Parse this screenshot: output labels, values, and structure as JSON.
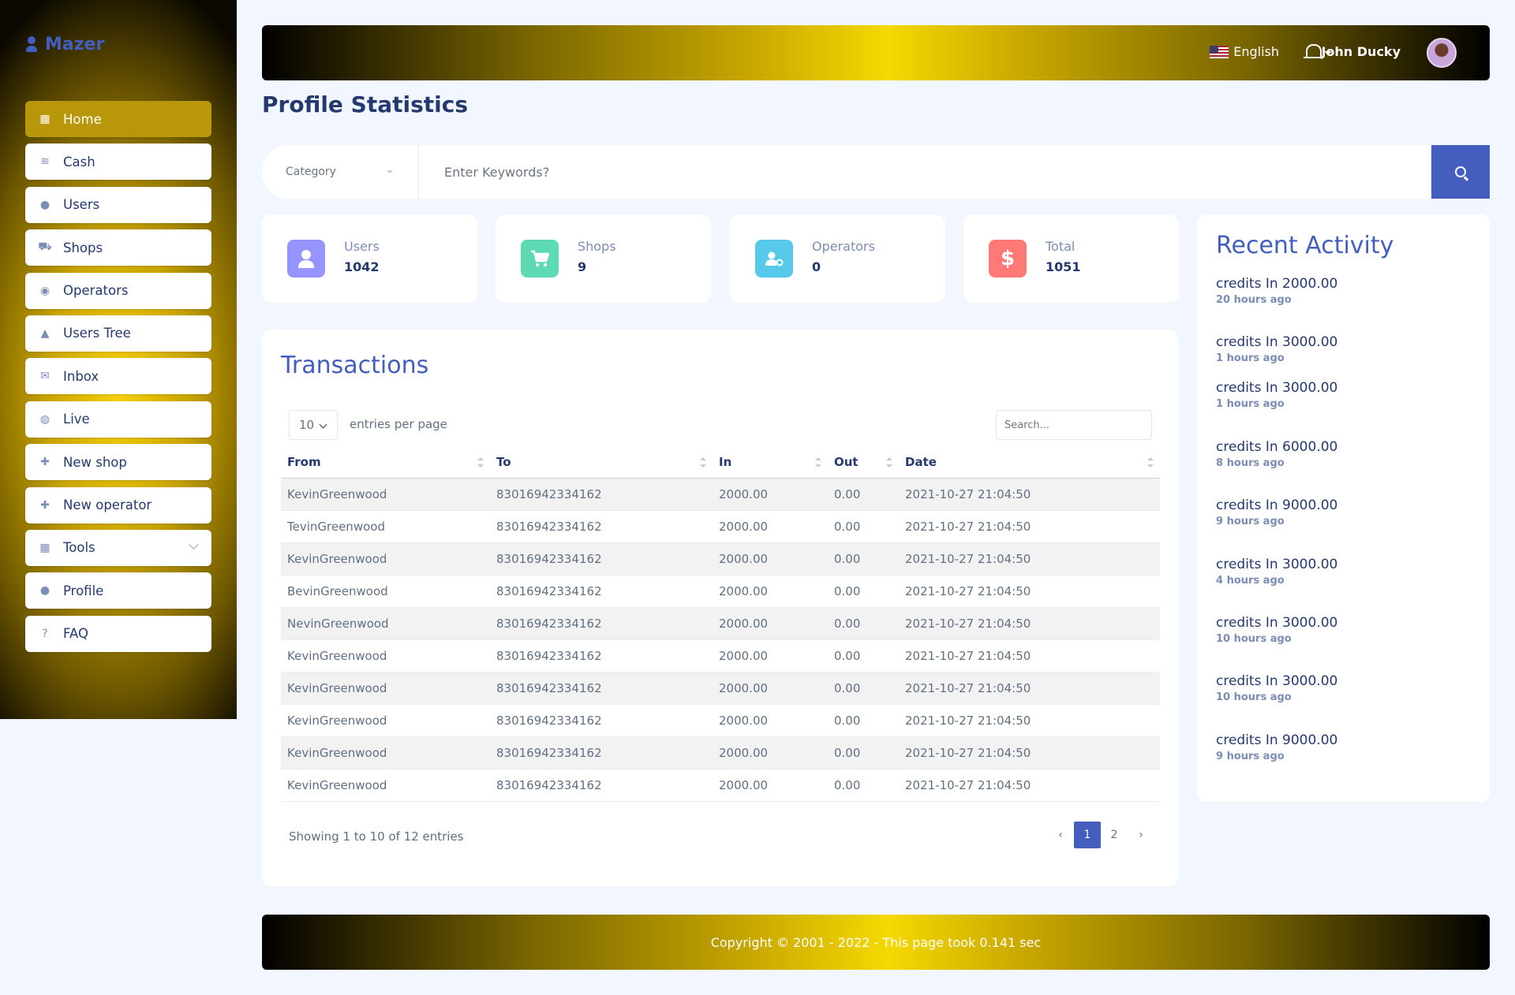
{
  "app": {
    "name": "Mazer"
  },
  "sidebar": {
    "items": [
      {
        "label": "Home",
        "icon": "grid-icon",
        "glyph": "▦"
      },
      {
        "label": "Cash",
        "icon": "stack-icon",
        "glyph": "≋"
      },
      {
        "label": "Users",
        "icon": "user-icon",
        "glyph": "●"
      },
      {
        "label": "Shops",
        "icon": "cart-icon",
        "glyph": "⛟"
      },
      {
        "label": "Operators",
        "icon": "record-icon",
        "glyph": "◉"
      },
      {
        "label": "Users Tree",
        "icon": "tree-icon",
        "glyph": "▲"
      },
      {
        "label": "Inbox",
        "icon": "envelope-icon",
        "glyph": "✉"
      },
      {
        "label": "Live",
        "icon": "globe-icon",
        "glyph": "◍"
      },
      {
        "label": "New shop",
        "icon": "plus-icon",
        "glyph": "✚"
      },
      {
        "label": "New operator",
        "icon": "plus-icon",
        "glyph": "✚"
      },
      {
        "label": "Tools",
        "icon": "grid-icon",
        "glyph": "▦"
      },
      {
        "label": "Profile",
        "icon": "user-icon",
        "glyph": "●"
      },
      {
        "label": "FAQ",
        "icon": "question-icon",
        "glyph": "?"
      }
    ]
  },
  "header": {
    "language": "English",
    "user_name": "John Ducky"
  },
  "page": {
    "title": "Profile Statistics"
  },
  "search": {
    "category_placeholder": "Category",
    "keyword_placeholder": "Enter Keywords?"
  },
  "stats": [
    {
      "label": "Users",
      "value": "1042",
      "color": "#9694ff",
      "icon": "user-icon",
      "glyph": "👤"
    },
    {
      "label": "Shops",
      "value": "9",
      "color": "#57caeb",
      "icon": "cart-icon",
      "glyph": "🛒"
    },
    {
      "label": "Operators",
      "value": "0",
      "color": "#56b6f7",
      "icon": "user-gear-icon",
      "glyph": "⚙"
    },
    {
      "label": "Total",
      "value": "1051",
      "color": "#ff7976",
      "icon": "dollar-icon",
      "glyph": "$"
    }
  ],
  "transactions": {
    "title": "Transactions",
    "entries_value": "10",
    "entries_label": "entries per page",
    "search_placeholder": "Search...",
    "columns": [
      "From",
      "To",
      "In",
      "Out",
      "Date"
    ],
    "rows": [
      [
        "KevinGreenwood",
        "83016942334162",
        "2000.00",
        "0.00",
        "2021-10-27 21:04:50"
      ],
      [
        "TevinGreenwood",
        "83016942334162",
        "2000.00",
        "0.00",
        "2021-10-27 21:04:50"
      ],
      [
        "KevinGreenwood",
        "83016942334162",
        "2000.00",
        "0.00",
        "2021-10-27 21:04:50"
      ],
      [
        "BevinGreenwood",
        "83016942334162",
        "2000.00",
        "0.00",
        "2021-10-27 21:04:50"
      ],
      [
        "NevinGreenwood",
        "83016942334162",
        "2000.00",
        "0.00",
        "2021-10-27 21:04:50"
      ],
      [
        "KevinGreenwood",
        "83016942334162",
        "2000.00",
        "0.00",
        "2021-10-27 21:04:50"
      ],
      [
        "KevinGreenwood",
        "83016942334162",
        "2000.00",
        "0.00",
        "2021-10-27 21:04:50"
      ],
      [
        "KevinGreenwood",
        "83016942334162",
        "2000.00",
        "0.00",
        "2021-10-27 21:04:50"
      ],
      [
        "KevinGreenwood",
        "83016942334162",
        "2000.00",
        "0.00",
        "2021-10-27 21:04:50"
      ],
      [
        "KevinGreenwood",
        "83016942334162",
        "2000.00",
        "0.00",
        "2021-10-27 21:04:50"
      ]
    ],
    "showing": "Showing 1 to 10 of 12 entries",
    "pagination": {
      "prev": "‹",
      "pages": [
        "1",
        "2"
      ],
      "next": "›"
    }
  },
  "recent_activity": {
    "title": "Recent Activity",
    "items": [
      {
        "text": "credits In 2000.00",
        "time": "20 hours ago"
      },
      {
        "text": "credits In 3000.00",
        "time": "1 hours ago"
      },
      {
        "text": "credits In 3000.00",
        "time": "1 hours ago"
      },
      {
        "text": "credits In 6000.00",
        "time": "8 hours ago"
      },
      {
        "text": "credits In 9000.00",
        "time": "9 hours ago"
      },
      {
        "text": "credits In 3000.00",
        "time": "4 hours ago"
      },
      {
        "text": "credits In 3000.00",
        "time": "10 hours ago"
      },
      {
        "text": "credits In 3000.00",
        "time": "10 hours ago"
      },
      {
        "text": "credits In 9000.00",
        "time": "9 hours ago"
      }
    ]
  },
  "footer": {
    "text": "Copyright © 2001 - 2022 - This page took 0.141 sec"
  },
  "colors": {
    "accent": "#435ebe",
    "active_menu": "#b8980a",
    "gold": "#f5d900"
  }
}
